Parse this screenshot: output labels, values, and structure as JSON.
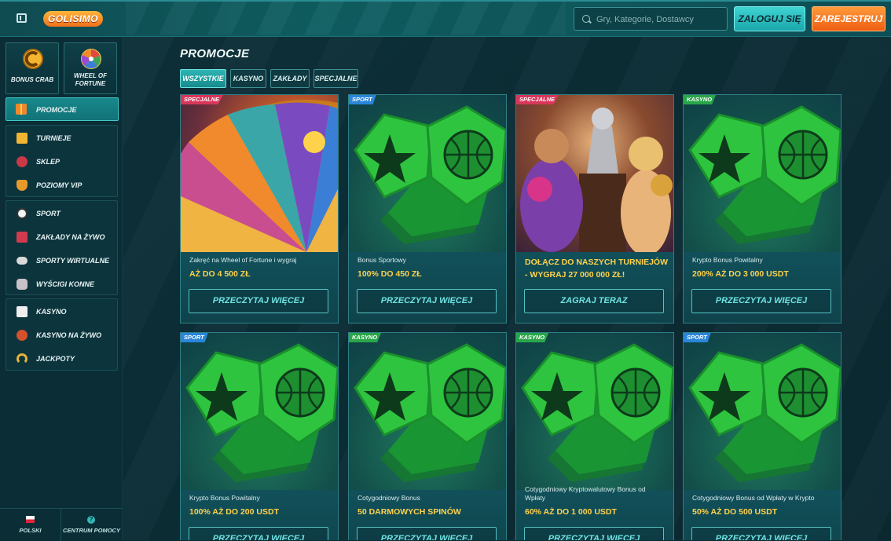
{
  "header": {
    "logo": "GOLISIMO",
    "search_placeholder": "Gry, Kategorie, Dostawcy",
    "login_label": "ZALOGUJ SIĘ",
    "register_label": "ZAREJESTRUJ"
  },
  "sidebar": {
    "tiles": [
      {
        "label": "BONUS CRAB"
      },
      {
        "label": "WHEEL OF FORTUNE"
      }
    ],
    "active_item": {
      "label": "PROMOCJE"
    },
    "groups": [
      {
        "items": [
          {
            "label": "TURNIEJE",
            "icon": "trophy-icon"
          },
          {
            "label": "SKLEP",
            "icon": "shop-icon"
          },
          {
            "label": "POZIOMY VIP",
            "icon": "vip-shield-icon"
          }
        ]
      },
      {
        "items": [
          {
            "label": "SPORT",
            "icon": "soccer-ball-icon"
          },
          {
            "label": "ZAKŁADY NA ŻYWO",
            "icon": "live-betting-icon"
          },
          {
            "label": "SPORTY WIRTUALNE",
            "icon": "gamepad-icon"
          },
          {
            "label": "WYŚCIGI KONNE",
            "icon": "horse-icon"
          }
        ]
      },
      {
        "items": [
          {
            "label": "KASYNO",
            "icon": "dice-icon"
          },
          {
            "label": "KASYNO NA ŻYWO",
            "icon": "roulette-icon"
          },
          {
            "label": "JACKPOTY",
            "icon": "horseshoe-icon"
          }
        ]
      }
    ],
    "language": "POLSKI",
    "help": "CENTRUM POMOCY",
    "help_icon_glyph": "?"
  },
  "main": {
    "title": "PROMOCJE",
    "filters": [
      "WSZYSTKIE",
      "KASYNO",
      "ZAKŁADY",
      "SPECJALNE"
    ],
    "cards": [
      {
        "badge": "SPECJALNE",
        "badge_color": "#d8365a",
        "subtitle": "Zakręć na Wheel of Fortune i wygraj",
        "amount": "AŻ DO 4 500 ZŁ",
        "cta": "PRZECZYTAJ WIĘCEJ"
      },
      {
        "badge": "SPORT",
        "badge_color": "#2a86d8",
        "subtitle": "Bonus Sportowy",
        "amount": "100% DO 450 ZŁ",
        "cta": "PRZECZYTAJ WIĘCEJ"
      },
      {
        "badge": "SPECJALNE",
        "badge_color": "#d8365a",
        "subtitle": "",
        "amount": "DOŁĄCZ DO NASZYCH TURNIEJÓW - WYGRAJ 27 000 000 ZŁ!",
        "cta": "ZAGRAJ TERAZ"
      },
      {
        "badge": "KASYNO",
        "badge_color": "#2aa64a",
        "subtitle": "Krypto Bonus Powitalny",
        "amount": "200% AŻ DO 3 000 USDT",
        "cta": "PRZECZYTAJ WIĘCEJ"
      },
      {
        "badge": "SPORT",
        "badge_color": "#2a86d8",
        "subtitle": "Krypto Bonus Powitalny",
        "amount": "100% AŻ DO 200 USDT",
        "cta": "PRZECZYTAJ WIĘCEJ"
      },
      {
        "badge": "KASYNO",
        "badge_color": "#2aa64a",
        "subtitle": "Cotygodniowy Bonus",
        "amount": "50 DARMOWYCH SPINÓW",
        "cta": "PRZECZYTAJ WIĘCEJ"
      },
      {
        "badge": "KASYNO",
        "badge_color": "#2aa64a",
        "subtitle": "Cotygodniowy Kryptowalutowy Bonus od Wpłaty",
        "amount": "60% AŻ DO 1 000 USDT",
        "cta": "PRZECZYTAJ WIĘCEJ"
      },
      {
        "badge": "SPORT",
        "badge_color": "#2a86d8",
        "subtitle": "Cotygodniowy Bonus od Wpłaty w Krypto",
        "amount": "50% AŻ DO 500 USDT",
        "cta": "PRZECZYTAJ WIĘCEJ"
      }
    ]
  }
}
